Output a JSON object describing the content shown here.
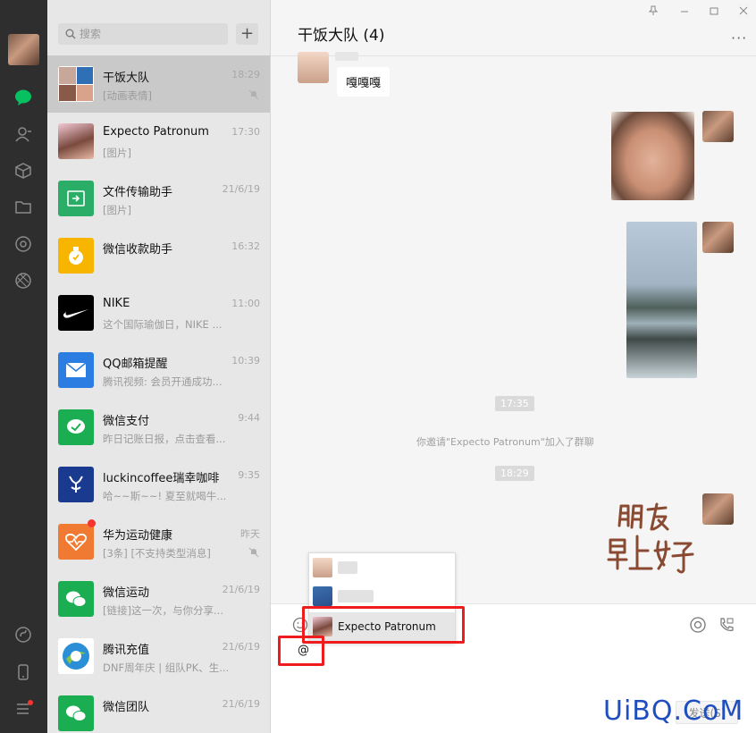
{
  "nav": {
    "icons": [
      "chat-icon",
      "contacts-icon",
      "favorites-icon",
      "files-icon",
      "moments-icon",
      "channels-icon",
      "mini-program-icon",
      "phone-icon",
      "menu-icon"
    ]
  },
  "search": {
    "placeholder": "搜索",
    "add_label": "+"
  },
  "chats": [
    {
      "name": "干饭大队",
      "time": "18:29",
      "msg": "[动画表情]",
      "muted": true,
      "active": true
    },
    {
      "name": "Expecto Patronum",
      "time": "17:30",
      "msg": "[图片]"
    },
    {
      "name": "文件传输助手",
      "time": "21/6/19",
      "msg": "[图片]"
    },
    {
      "name": "微信收款助手",
      "time": "16:32",
      "msg": ""
    },
    {
      "name": "NIKE",
      "time": "11:00",
      "msg": "这个国际瑜伽日，NIKE ..."
    },
    {
      "name": "QQ邮箱提醒",
      "time": "10:39",
      "msg": "腾讯视频: 会员开通成功..."
    },
    {
      "name": "微信支付",
      "time": "9:44",
      "msg": "昨日记账日报，点击查看..."
    },
    {
      "name": "luckincoffee瑞幸咖啡",
      "time": "9:35",
      "msg": "哈~~斯~~! 夏至就喝牛..."
    },
    {
      "name": "华为运动健康",
      "time": "昨天",
      "msg": "[3条] [不支持类型消息]",
      "muted": true,
      "badge": true
    },
    {
      "name": "微信运动",
      "time": "21/6/19",
      "msg": "[链接]这一次，与你分享..."
    },
    {
      "name": "腾讯充值",
      "time": "21/6/19",
      "msg": "DNF周年庆 | 组队PK、生..."
    },
    {
      "name": "微信团队",
      "time": "21/6/19",
      "msg": ""
    }
  ],
  "chat": {
    "title": "干饭大队 (4)",
    "more": "···",
    "bubble_text": "嘎嘎嘎",
    "time1": "17:35",
    "system_msg": "你邀请\"Expecto Patronum\"加入了群聊",
    "time2": "18:29",
    "sticker_line1": "朋友",
    "sticker_line2": "早上好",
    "typed": "@",
    "send_label": "发送(S)"
  },
  "mention_popup": {
    "selected": "Expecto Patronum"
  },
  "watermark": "UiBQ.CoM",
  "colors": {
    "accent": "#07c160",
    "nav_bg": "#2e2e2e",
    "highlight": "#ee1c1c"
  }
}
